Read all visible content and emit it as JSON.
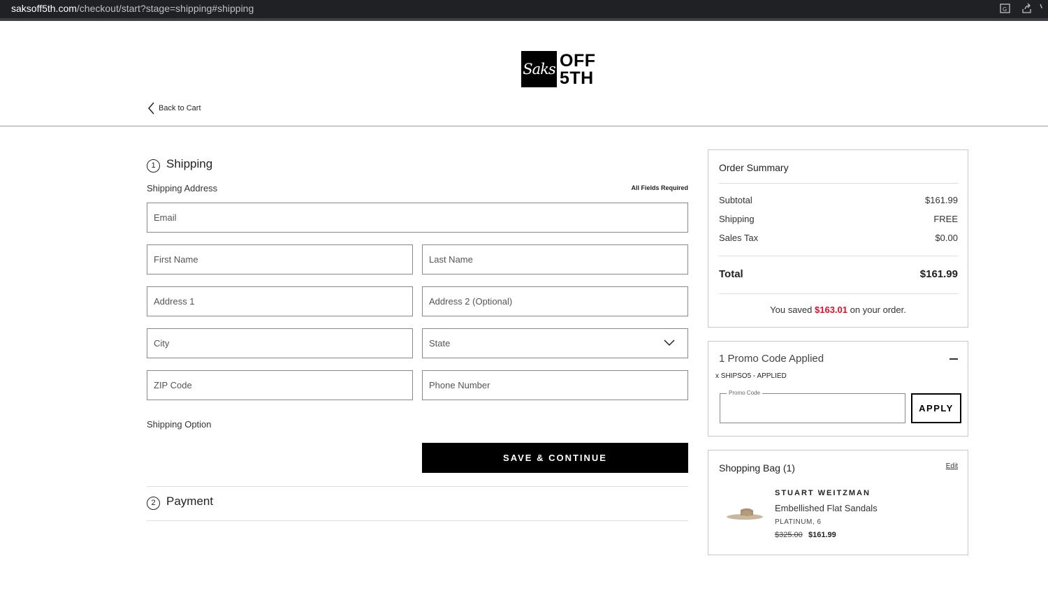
{
  "browser": {
    "url_host": "saksoff5th.com",
    "url_path": "/checkout/start?stage=shipping#shipping"
  },
  "logo": {
    "script": "Saks",
    "line1": "OFF",
    "line2": "5TH"
  },
  "nav": {
    "back_label": "Back to Cart"
  },
  "shipping": {
    "step_number": "1",
    "title": "Shipping",
    "address_label": "Shipping Address",
    "required_note": "All Fields Required",
    "fields": {
      "email": "Email",
      "first_name": "First Name",
      "last_name": "Last Name",
      "address1": "Address 1",
      "address2": "Address 2 (Optional)",
      "city": "City",
      "state": "State",
      "zip": "ZIP Code",
      "phone": "Phone Number"
    },
    "option_label": "Shipping Option",
    "save_button": "SAVE & CONTINUE"
  },
  "payment": {
    "step_number": "2",
    "title": "Payment"
  },
  "order_summary": {
    "title": "Order Summary",
    "subtotal_label": "Subtotal",
    "subtotal_value": "$161.99",
    "shipping_label": "Shipping",
    "shipping_value": "FREE",
    "tax_label": "Sales Tax",
    "tax_value": "$0.00",
    "total_label": "Total",
    "total_value": "$161.99",
    "saved_prefix": "You saved",
    "saved_amount": "$163.01",
    "saved_suffix": "on your order."
  },
  "promo": {
    "title": "1 Promo Code Applied",
    "applied": "x SHIPSO5 - APPLIED",
    "input_label": "Promo Code",
    "apply_button": "APPLY"
  },
  "bag": {
    "title": "Shopping Bag (1)",
    "edit_label": "Edit",
    "item": {
      "brand": "STUART WEITZMAN",
      "name": "Embellished Flat Sandals",
      "variant": "PLATINUM, 6",
      "price_old": "$325.00",
      "price_new": "$161.99"
    }
  },
  "colors": {
    "accent_red": "#e0102a",
    "button_black": "#000000"
  }
}
